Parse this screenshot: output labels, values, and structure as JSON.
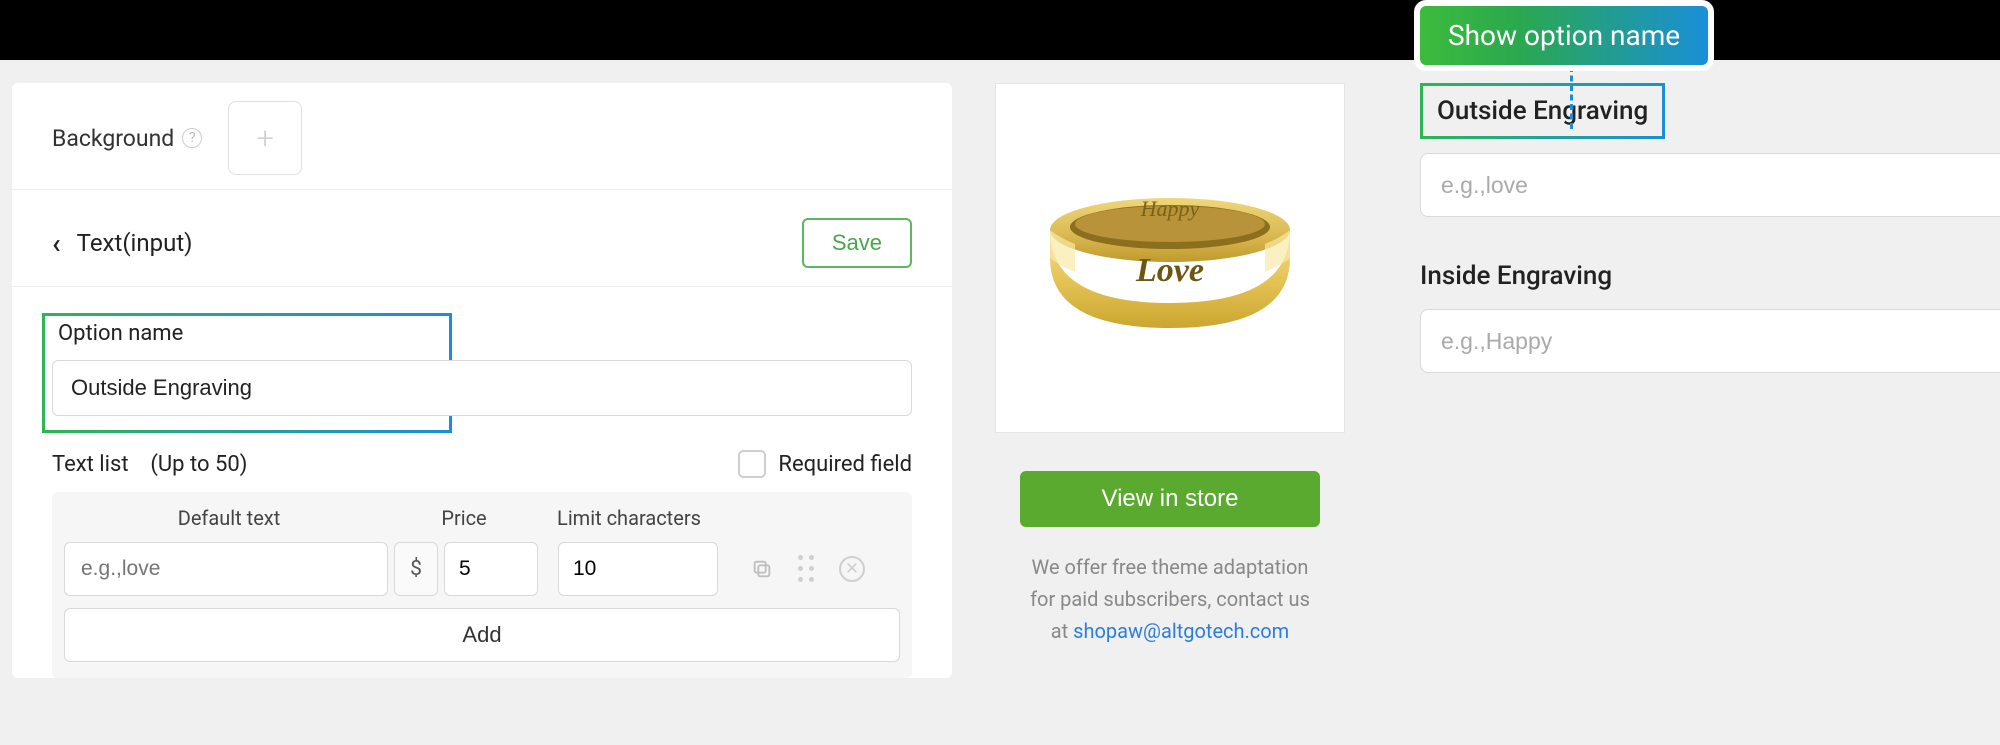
{
  "callout": {
    "text": "Show option name"
  },
  "left_panel": {
    "background_label": "Background",
    "section_title": "Text(input)",
    "save_label": "Save",
    "option_name_label": "Option name",
    "option_name_value": "Outside Engraving",
    "text_list_label": "Text list",
    "text_list_limit": "(Up to 50)",
    "required_field_label": "Required field",
    "columns": {
      "default_text": "Default text",
      "price": "Price",
      "limit": "Limit characters"
    },
    "row": {
      "default_placeholder": "e.g.,love",
      "currency": "$",
      "price_value": "5",
      "limit_value": "10"
    },
    "add_label": "Add"
  },
  "preview": {
    "ring_top_text": "Happy",
    "ring_bottom_text": "Love",
    "view_store_label": "View in store",
    "offer_line1": "We offer free theme adaptation",
    "offer_line2": "for paid subscribers, contact us",
    "offer_line3_prefix": "at ",
    "offer_email": "shopaw@altgotech.com"
  },
  "form_preview": {
    "field1_label": "Outside Engraving",
    "field1_placeholder": "e.g.,love",
    "field2_label": "Inside Engraving",
    "field2_placeholder": "e.g.,Happy"
  }
}
